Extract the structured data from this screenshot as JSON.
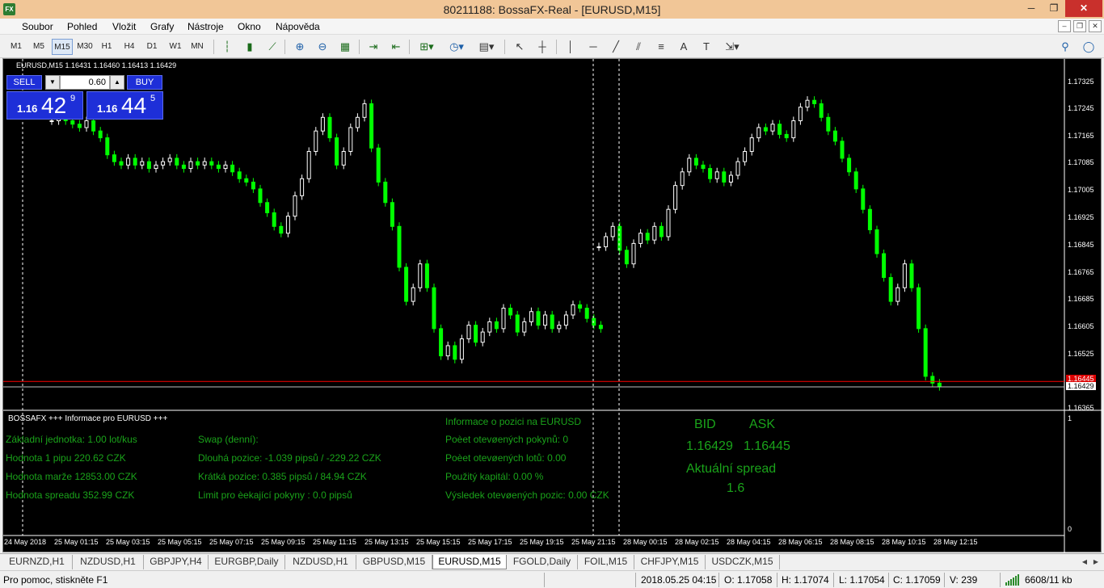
{
  "window": {
    "title": "80211188: BossaFX-Real - [EURUSD,M15]",
    "minimize": "─",
    "restore": "❐",
    "close": "✕"
  },
  "menu": [
    "Soubor",
    "Pohled",
    "Vložit",
    "Grafy",
    "Nástroje",
    "Okno",
    "Nápověda"
  ],
  "mdi": {
    "minimize": "–",
    "restore": "❐",
    "close": "✕"
  },
  "toolbar": {
    "timeframes": [
      "M1",
      "M5",
      "M15",
      "M30",
      "H1",
      "H4",
      "D1",
      "W1",
      "MN"
    ],
    "active_timeframe": "M15"
  },
  "chart": {
    "label": "EURUSD,M15  1.16431 1.16460 1.16413 1.16429",
    "symbol": "EURUSD",
    "timeframe": "M15",
    "ohlc": {
      "open": 1.16431,
      "high": 1.1646,
      "low": 1.16413,
      "close": 1.16429
    },
    "price_axis": [
      "1.17325",
      "1.17245",
      "1.17165",
      "1.17085",
      "1.17005",
      "1.16925",
      "1.16845",
      "1.16765",
      "1.16685",
      "1.16605",
      "1.16525",
      "1.16445",
      "1.16429",
      "1.16365"
    ],
    "ask_line_label": "1.16445",
    "bid_line_label": "1.16429",
    "indicator_axis": [
      "1",
      "0"
    ],
    "time_axis": [
      "24 May 2018",
      "25 May 01:15",
      "25 May 03:15",
      "25 May 05:15",
      "25 May 07:15",
      "25 May 09:15",
      "25 May 11:15",
      "25 May 13:15",
      "25 May 15:15",
      "25 May 17:15",
      "25 May 19:15",
      "25 May 21:15",
      "28 May 00:15",
      "28 May 02:15",
      "28 May 04:15",
      "28 May 06:15",
      "28 May 08:15",
      "28 May 10:15",
      "28 May 12:15"
    ],
    "colors": {
      "background": "#000000",
      "bull": "#ffffff",
      "bear": "#00ff00",
      "bid_line": "#c0c0c0",
      "ask_line": "#ff0000",
      "grid": "#ffffff"
    }
  },
  "trade_panel": {
    "sell_label": "SELL",
    "buy_label": "BUY",
    "lot": "0.60",
    "lot_down": "▼",
    "lot_up": "▲",
    "sell_price": {
      "big": "1.16",
      "pips": "42",
      "frac": "9"
    },
    "buy_price": {
      "big": "1.16",
      "pips": "44",
      "frac": "5"
    }
  },
  "info_panel": {
    "title": "BOSSAFX +++ Informace pro EURUSD +++",
    "col1": [
      "Základní jednotka: 1.00  lot/kus",
      "Hodnota 1 pipu 220.62 CZK",
      "Hodnota marže 12853.00 CZK",
      "Hodnota spreadu 352.99 CZK"
    ],
    "col2": [
      "Swap (denní):",
      "Dlouhá pozice:   -1.039 pipsů /  -229.22 CZK",
      "Krátká pozice:  0.385 pipsů /  84.94 CZK",
      "Limit pro èekající pokyny : 0.0  pipsů"
    ],
    "col3": [
      "Informace o pozici na EURUSD",
      "Poèet otevøených pokynů: 0",
      "Poèet otevøených lotů: 0.00",
      "Použitý kapitál: 0.00 %",
      "Výsledek otevøených pozic: 0.00 CZK"
    ],
    "bid_label": "BID",
    "ask_label": "ASK",
    "bid_value": "1.16429",
    "ask_value": "1.16445",
    "spread_label": "Aktuální spread",
    "spread_value": "1.6"
  },
  "tabs": [
    "EURNZD,H1",
    "NZDUSD,H1",
    "GBPJPY,H4",
    "EURGBP,Daily",
    "NZDUSD,H1",
    "GBPUSD,M15",
    "EURUSD,M15",
    "FGOLD,Daily",
    "FOIL,M15",
    "CHFJPY,M15",
    "USDCZK,M15"
  ],
  "active_tab": "EURUSD,M15",
  "tab_arrows": {
    "left": "◀",
    "right": "▶"
  },
  "status": {
    "help": "Pro pomoc, stiskněte F1",
    "datetime": "2018.05.25 04:15",
    "open": "O: 1.17058",
    "high": "H: 1.17074",
    "low": "L: 1.17054",
    "close": "C: 1.17059",
    "volume": "V: 239",
    "traffic": "6608/11 kb"
  }
}
